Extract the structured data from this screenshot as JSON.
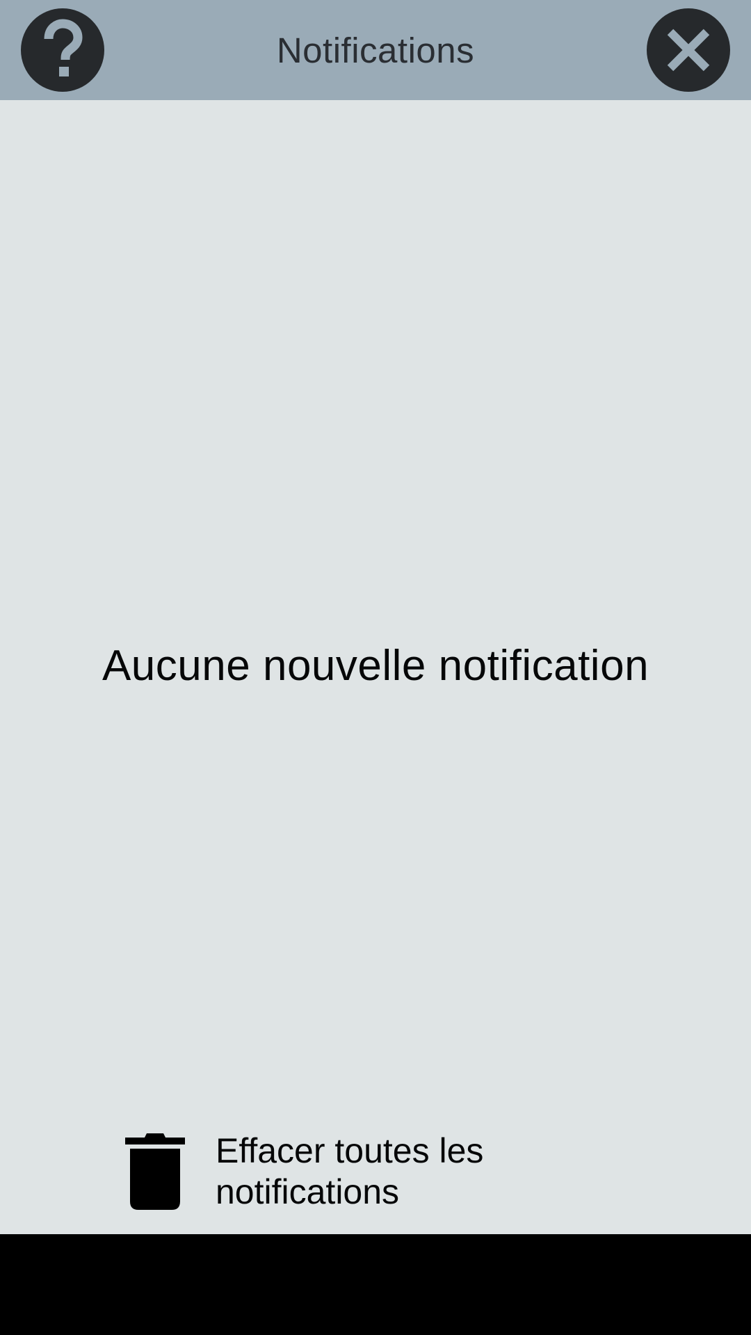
{
  "header": {
    "title": "Notifications",
    "help_icon": "question-mark-icon",
    "close_icon": "close-icon",
    "background_color": "#9aabb7",
    "button_color": "#26292c",
    "icon_color": "#9aabb7"
  },
  "main": {
    "empty_message": "Aucune nouvelle notification",
    "background_color": "#dfe4e5"
  },
  "footer": {
    "clear_label": "Effacer toutes les notifications",
    "clear_icon": "trash-icon"
  },
  "nav_bar": {
    "background_color": "#000000"
  }
}
